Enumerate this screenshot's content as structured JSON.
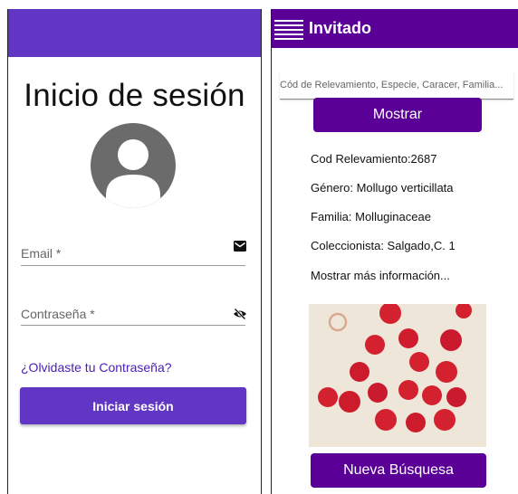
{
  "login": {
    "title": "Inicio de sesión",
    "email_label": "Email *",
    "password_label": "Contraseña *",
    "forgot_link": "¿Olvidaste tu Contraseña?",
    "submit_label": "Iniciar sesión",
    "icons": {
      "avatar": "person-avatar-icon",
      "email": "envelope-icon",
      "password": "eye-off-icon"
    },
    "colors": {
      "appbar": "#6236c4",
      "button": "#6236c4",
      "link": "#4a20b8"
    }
  },
  "results": {
    "appbar_title": "Invitado",
    "search_placeholder": "Cód de Relevamiento, Especie, Caracer, Familia...",
    "show_button": "Mostrar",
    "fields": [
      "Cod Relevamiento:2687",
      "Género: Mollugo verticillata",
      "Familia: Molluginaceae",
      "Coleccionista: Salgado,C. 1"
    ],
    "more_info": "Mostrar más información...",
    "new_search_button": "Nueva Búsquesa",
    "icons": {
      "menu": "hamburger-menu-icon"
    },
    "colors": {
      "appbar": "#5a0096",
      "button": "#5a0096"
    }
  }
}
